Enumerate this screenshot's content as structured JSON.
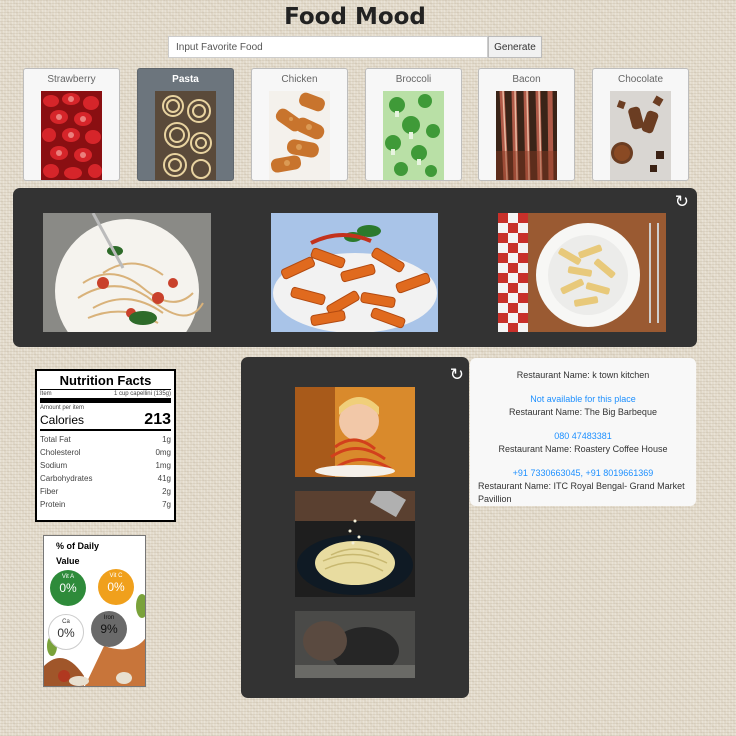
{
  "header": {
    "title": "Food Mood",
    "search_placeholder": "Input Favorite Food",
    "generate_label": "Generate"
  },
  "foods": [
    {
      "label": "Strawberry",
      "icon": "strawberry-photo",
      "active": false
    },
    {
      "label": "Pasta",
      "icon": "pasta-photo",
      "active": true
    },
    {
      "label": "Chicken",
      "icon": "chicken-photo",
      "active": false
    },
    {
      "label": "Broccoli",
      "icon": "broccoli-photo",
      "active": false
    },
    {
      "label": "Bacon",
      "icon": "bacon-photo",
      "active": false
    },
    {
      "label": "Chocolate",
      "icon": "chocolate-photo",
      "active": false
    }
  ],
  "gallery": {
    "refresh_icon": "↻"
  },
  "videos": {
    "refresh_icon": "↻"
  },
  "nutrition": {
    "title": "Nutrition Facts",
    "item_label": "Item",
    "item_value": "1 cup capellini (135g)",
    "amount_label": "Amount per item",
    "calories_label": "Calories",
    "calories_value": "213",
    "rows": [
      {
        "name": "Total Fat",
        "value": "1g"
      },
      {
        "name": "Cholesterol",
        "value": "0mg"
      },
      {
        "name": "Sodium",
        "value": "1mg"
      },
      {
        "name": "Carbohydrates",
        "value": "41g"
      },
      {
        "name": "Fiber",
        "value": "2g"
      },
      {
        "name": "Protein",
        "value": "7g"
      }
    ]
  },
  "daily_value": {
    "title_line1": "% of Daily",
    "title_line2": "Value",
    "vit_a": {
      "label": "Vit A",
      "value": "0%",
      "color": "#2e8b3a"
    },
    "vit_c": {
      "label": "Vit C",
      "value": "0%",
      "color": "#f0a01c"
    },
    "ca": {
      "label": "Ca",
      "value": "0%",
      "color": "#ffffff"
    },
    "iron": {
      "label": "Iron",
      "value": "9%",
      "color": "#6a6a6a"
    }
  },
  "restaurants": {
    "entries": [
      {
        "name": "Restaurant Name: k town kitchen",
        "phone": "Not available for this place"
      },
      {
        "name": "Restaurant Name: The Big Barbeque",
        "phone": "080 47483381"
      },
      {
        "name": "Restaurant Name: Roastery Coffee House",
        "phone": "+91 7330663045, +91 8019661369"
      },
      {
        "name": "Restaurant Name: ITC Royal Bengal- Grand Market Pavillion",
        "phone": ""
      }
    ]
  }
}
